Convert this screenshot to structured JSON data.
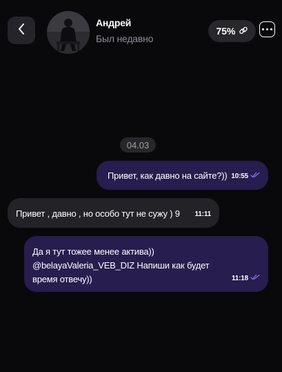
{
  "header": {
    "contact_name": "Андрей",
    "contact_status": "Был недавно",
    "match_percent": "75%"
  },
  "chat": {
    "date_separator": "04.03",
    "messages": [
      {
        "direction": "outgoing",
        "text": "Привет, как давно на сайте?))",
        "time": "10:55",
        "read": true
      },
      {
        "direction": "incoming",
        "text": "Привет , давно , но особо тут не сужу ) 9",
        "time": "11:11"
      },
      {
        "direction": "outgoing",
        "lines": [
          "Да я тут тожее менее актива))",
          "@belayaValeria_VEB_DIZ Напиши как будет",
          "время отвечу))"
        ],
        "time": "11:18",
        "read": true
      }
    ]
  },
  "colors": {
    "background": "#09090b",
    "outgoing_bubble": "#271d4f",
    "incoming_bubble": "#232327",
    "read_check": "#8b6cf2"
  },
  "icons": {
    "back": "chevron-left-icon",
    "link": "link-icon",
    "menu": "more-dots-icon",
    "read": "double-check-icon"
  }
}
